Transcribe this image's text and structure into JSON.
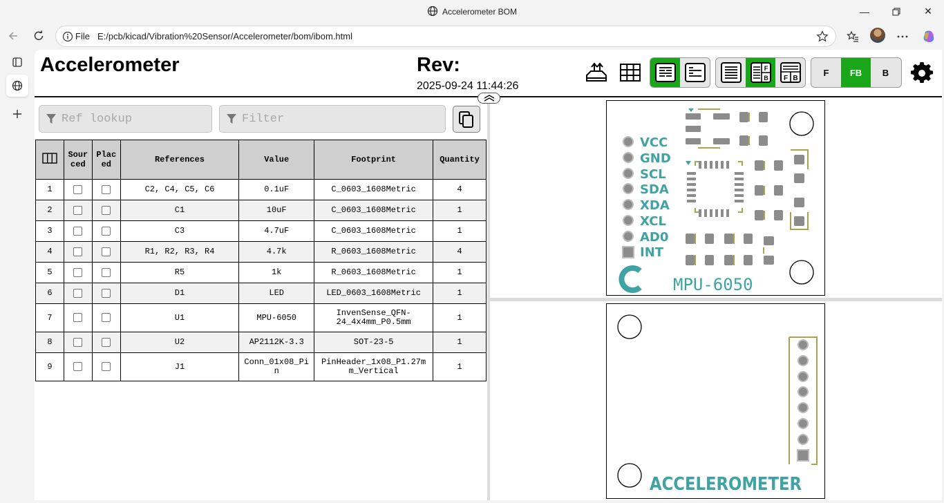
{
  "window": {
    "title": "Accelerometer BOM",
    "controls": {
      "minimize": "—",
      "maximize": "▢",
      "close": "✕"
    }
  },
  "address_bar": {
    "scheme_label": "File",
    "url": "E:/pcb/kicad/Vibration%20Sensor/Accelerometer/bom/ibom.html"
  },
  "header": {
    "title": "Accelerometer",
    "rev_label": "Rev:",
    "date": "2025-09-24 11:44:26",
    "layer_buttons": [
      "F",
      "FB",
      "B"
    ],
    "active_layer": "FB"
  },
  "search": {
    "ref_placeholder": "Ref lookup",
    "filter_placeholder": "Filter"
  },
  "table": {
    "columns": [
      "Sourced",
      "Placed",
      "References",
      "Value",
      "Footprint",
      "Quantity"
    ],
    "column_headers_display": {
      "sourced": [
        "Sour",
        "ced"
      ],
      "placed": [
        "Plac",
        "ed"
      ]
    },
    "rows": [
      {
        "n": "1",
        "refs": "C2, C4, C5, C6",
        "value": "0.1uF",
        "footprint": "C_0603_1608Metric",
        "qty": "4"
      },
      {
        "n": "2",
        "refs": "C1",
        "value": "10uF",
        "footprint": "C_0603_1608Metric",
        "qty": "1"
      },
      {
        "n": "3",
        "refs": "C3",
        "value": "4.7uF",
        "footprint": "C_0603_1608Metric",
        "qty": "1"
      },
      {
        "n": "4",
        "refs": "R1, R2, R3, R4",
        "value": "4.7k",
        "footprint": "R_0603_1608Metric",
        "qty": "4"
      },
      {
        "n": "5",
        "refs": "R5",
        "value": "1k",
        "footprint": "R_0603_1608Metric",
        "qty": "1"
      },
      {
        "n": "6",
        "refs": "D1",
        "value": "LED",
        "footprint": "LED_0603_1608Metric",
        "qty": "1"
      },
      {
        "n": "7",
        "refs": "U1",
        "value": "MPU-6050",
        "footprint": "InvenSense_QFN-24_4x4mm_P0.5mm",
        "footprint_lines": [
          "InvenSense_QFN-",
          "24_4x4mm_P0.5mm"
        ],
        "qty": "1"
      },
      {
        "n": "8",
        "refs": "U2",
        "value": "AP2112K-3.3",
        "footprint": "SOT-23-5",
        "qty": "1"
      },
      {
        "n": "9",
        "refs": "J1",
        "value": "Conn_01x08_Pin",
        "value_lines": [
          "Conn_01x08_Pi",
          "n"
        ],
        "footprint": "PinHeader_1x08_P1.27mm_Vertical",
        "footprint_lines": [
          "PinHeader_1x08_P1.27m",
          "m_Vertical"
        ],
        "qty": "1"
      }
    ]
  },
  "front_board": {
    "pin_labels": [
      "VCC",
      "GND",
      "SCL",
      "SDA",
      "XDA",
      "XCL",
      "AD0",
      "INT"
    ],
    "silk_text": "MPU-6050"
  },
  "back_board": {
    "silk_text": "ACCELEROMETER"
  },
  "colors": {
    "accent_green": "#19a619",
    "silk_teal": "#3fa3a3",
    "pad_gray": "#8c8c8c",
    "courtyard_olive": "#a6a64c"
  }
}
